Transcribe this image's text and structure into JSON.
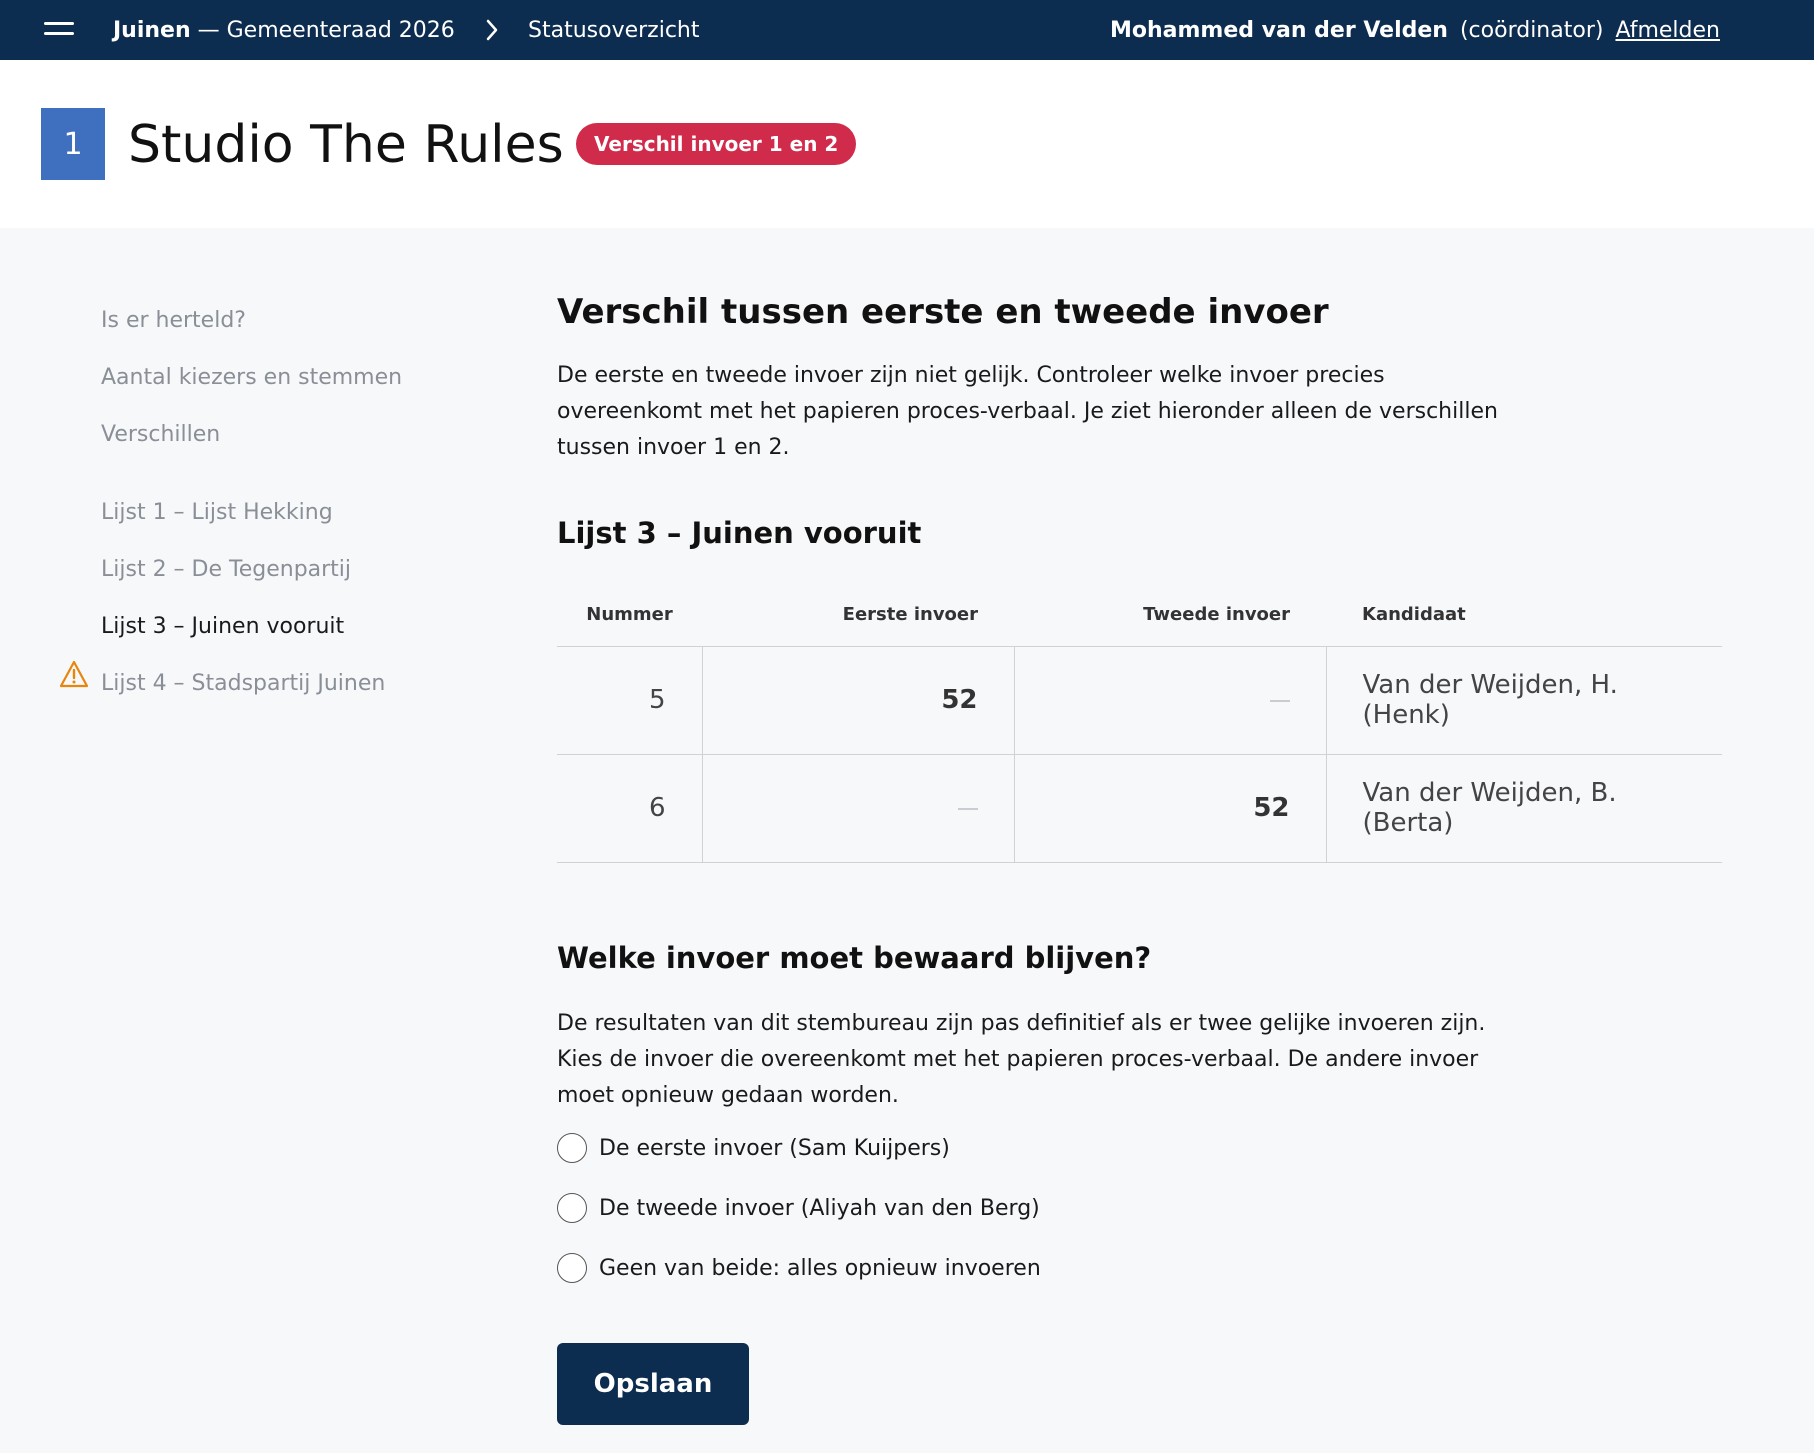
{
  "topbar": {
    "election_place": "Juinen",
    "election_name": "— Gemeenteraad 2026",
    "current_page": "Statusoverzicht",
    "user_name": "Mohammed van der Velden",
    "user_role": "(coördinator)",
    "logout_label": "Afmelden",
    "icons": {
      "menu": "hamburger-menu-icon",
      "separator": "chevron-right-icon"
    }
  },
  "header": {
    "station_number": "1",
    "station_name": "Studio The Rules",
    "status_label": "Verschil invoer 1 en 2",
    "colors": {
      "badge": "#3f6fbf",
      "status": "#d12b4b",
      "nav": "#0d2d50"
    }
  },
  "sidebar": {
    "items": [
      {
        "label": "Is er herteld?"
      },
      {
        "label": "Aantal kiezers en stemmen"
      },
      {
        "label": "Verschillen"
      },
      {
        "label": "Lijst 1 – Lijst Hekking"
      },
      {
        "label": "Lijst 2 – De Tegenpartij"
      },
      {
        "label": "Lijst 3 – Juinen vooruit",
        "active": true,
        "icon": "warning-icon"
      },
      {
        "label": "Lijst 4 – Stadspartij Juinen"
      }
    ]
  },
  "main": {
    "title": "Verschil tussen eerste en tweede invoer",
    "intro": "De eerste en tweede invoer zijn niet gelijk. Controleer welke invoer precies overeenkomt met het papieren proces-verbaal. Je ziet hieronder alleen de verschillen tussen invoer 1 en 2.",
    "list_title": "Lijst 3 – Juinen vooruit",
    "table": {
      "headers": {
        "number": "Nummer",
        "first": "Eerste invoer",
        "second": "Tweede invoer",
        "candidate": "Kandidaat"
      },
      "rows": [
        {
          "number": "5",
          "first": "52",
          "second": "",
          "candidate_line1": "Van der Weijden, H.",
          "candidate_line2": "(Henk)"
        },
        {
          "number": "6",
          "first": "",
          "second": "52",
          "candidate_line1": "Van der Weijden, B.",
          "candidate_line2": "(Berta)"
        }
      ]
    },
    "choice_title": "Welke invoer moet bewaard blijven?",
    "choice_intro": "De resultaten van dit stembureau zijn pas definitief als er twee gelijke invoeren zijn. Kies de invoer die overeenkomt met het papieren proces-verbaal. De andere invoer moet opnieuw gedaan worden.",
    "options": [
      {
        "label": "De eerste invoer (Sam Kuijpers)",
        "checked": false
      },
      {
        "label": "De tweede invoer (Aliyah van den Berg)",
        "checked": false
      },
      {
        "label": "Geen van beide: alles opnieuw invoeren",
        "checked": false
      }
    ],
    "save_label": "Opslaan"
  }
}
